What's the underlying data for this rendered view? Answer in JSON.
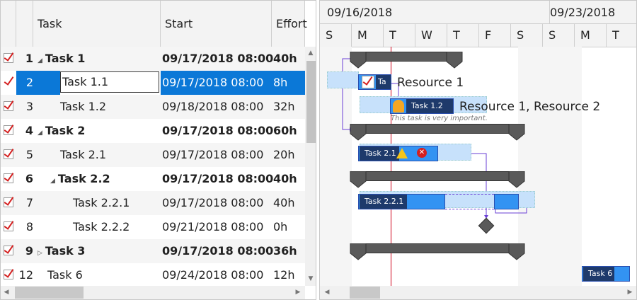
{
  "grid": {
    "headers": {
      "task": "Task",
      "start": "Start",
      "effort": "Effort"
    },
    "rows": [
      {
        "num": "1",
        "task": "Task 1",
        "start": "09/17/2018 08:00",
        "effort": "40h",
        "bold": true,
        "expander": "expanded"
      },
      {
        "num": "2",
        "task": "Task 1.1",
        "start": "09/17/2018 08:00",
        "effort": "8h",
        "bold": false,
        "selected": true
      },
      {
        "num": "3",
        "task": "Task 1.2",
        "start": "09/18/2018 08:00",
        "effort": "32h",
        "bold": false
      },
      {
        "num": "4",
        "task": "Task 2",
        "start": "09/17/2018 08:00",
        "effort": "60h",
        "bold": true,
        "expander": "expanded"
      },
      {
        "num": "5",
        "task": "Task 2.1",
        "start": "09/17/2018 08:00",
        "effort": "20h",
        "bold": false
      },
      {
        "num": "6",
        "task": "Task 2.2",
        "start": "09/17/2018 08:00",
        "effort": "40h",
        "bold": true,
        "expander": "expanded"
      },
      {
        "num": "7",
        "task": "Task 2.2.1",
        "start": "09/17/2018 08:00",
        "effort": "40h",
        "bold": false
      },
      {
        "num": "8",
        "task": "Task 2.2.2",
        "start": "09/21/2018 08:00",
        "effort": "0h",
        "bold": false
      },
      {
        "num": "9",
        "task": "Task 3",
        "start": "09/17/2018 08:00",
        "effort": "36h",
        "bold": true,
        "expander": "collapsed"
      },
      {
        "num": "12",
        "task": "Task 6",
        "start": "09/24/2018 08:00",
        "effort": "12h",
        "bold": false
      }
    ]
  },
  "gantt": {
    "weeks": [
      "09/16/2018",
      "09/23/2018"
    ],
    "days": [
      "S",
      "M",
      "T",
      "W",
      "T",
      "F",
      "S",
      "S",
      "M",
      "T"
    ],
    "bars": {
      "task11": "Ta",
      "task12": "Task 1.2",
      "task21": "Task 2.1",
      "task221": "Task 2.2.1",
      "task6": "Task 6"
    },
    "resources": {
      "task11": "Resource 1",
      "task12": "Resource 1, Resource 2"
    },
    "note": "This task is very important.",
    "colors": {
      "accent": "#0b78d7",
      "bar": "#3393f2",
      "label": "#1e3a6b",
      "today": "#d0021b",
      "link": "#6a3fd6"
    }
  }
}
